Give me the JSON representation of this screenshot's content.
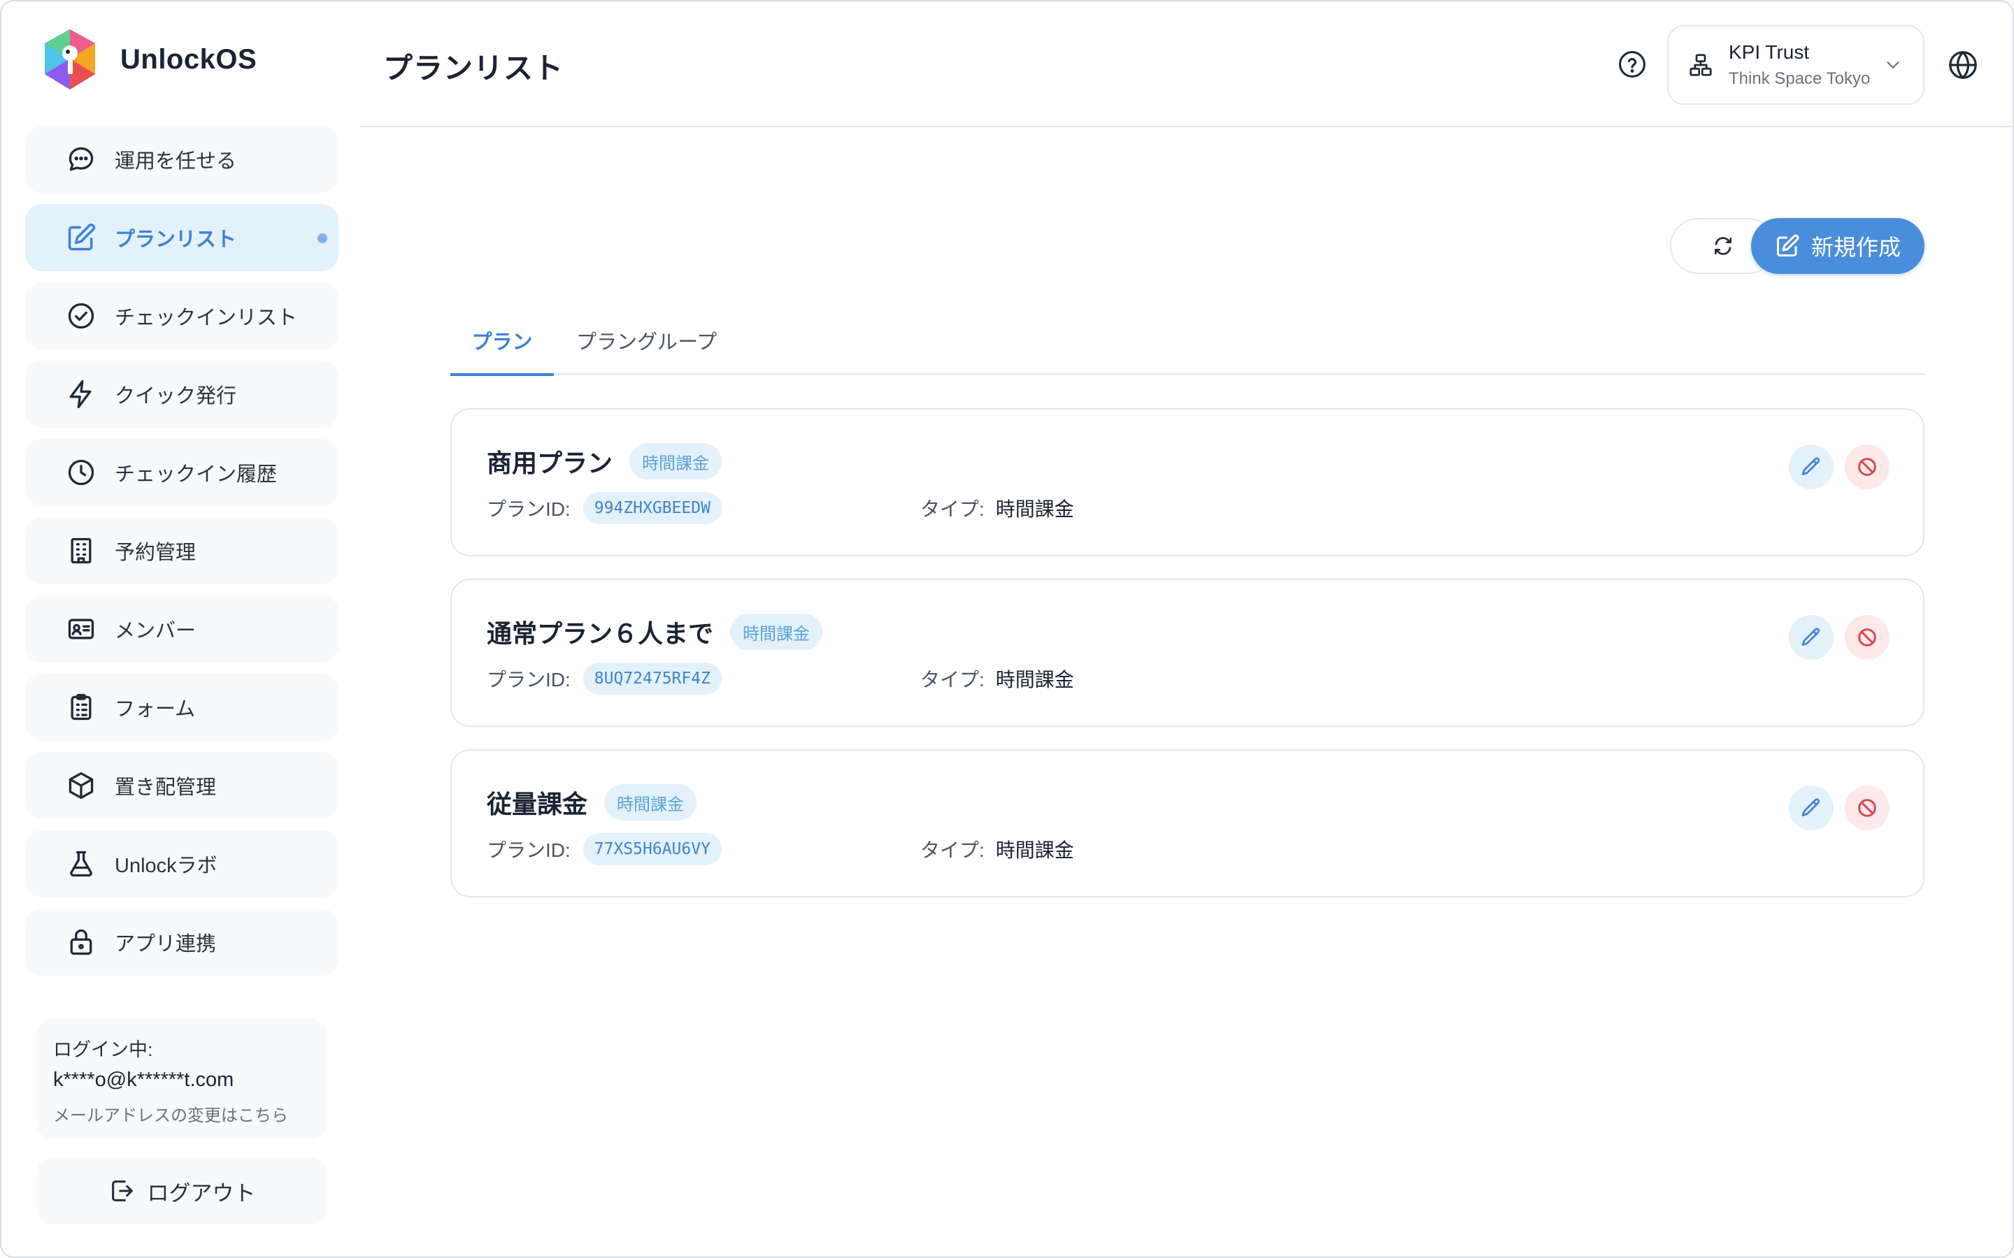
{
  "app": {
    "name": "UnlockOS"
  },
  "sidebar": {
    "items": [
      {
        "label": "運用を任せる",
        "icon": "chat-bubble-icon"
      },
      {
        "label": "プランリスト",
        "icon": "edit-square-icon",
        "active": true
      },
      {
        "label": "チェックインリスト",
        "icon": "check-circle-icon"
      },
      {
        "label": "クイック発行",
        "icon": "lightning-icon"
      },
      {
        "label": "チェックイン履歴",
        "icon": "clock-icon"
      },
      {
        "label": "予約管理",
        "icon": "building-icon"
      },
      {
        "label": "メンバー",
        "icon": "id-card-icon"
      },
      {
        "label": "フォーム",
        "icon": "clipboard-icon"
      },
      {
        "label": "置き配管理",
        "icon": "package-icon"
      },
      {
        "label": "Unlockラボ",
        "icon": "flask-icon"
      },
      {
        "label": "アプリ連携",
        "icon": "lock-icon"
      }
    ],
    "login": {
      "label": "ログイン中:",
      "email": "k****o@k******t.com",
      "change_link": "メールアドレスの変更はこちら"
    },
    "logout_label": "ログアウト"
  },
  "header": {
    "title": "プランリスト",
    "org": {
      "name": "KPI Trust",
      "space": "Think Space Tokyo"
    }
  },
  "toolbar": {
    "new_label": "新規作成"
  },
  "tabs": [
    {
      "label": "プラン",
      "active": true
    },
    {
      "label": "プラングループ",
      "active": false
    }
  ],
  "plans": [
    {
      "name": "商用プラン",
      "badge": "時間課金",
      "id_label": "プランID:",
      "id": "994ZHXGBEEDW",
      "type_label": "タイプ:",
      "type": "時間課金"
    },
    {
      "name": "通常プラン６人まで",
      "badge": "時間課金",
      "id_label": "プランID:",
      "id": "8UQ72475RF4Z",
      "type_label": "タイプ:",
      "type": "時間課金"
    },
    {
      "name": "従量課金",
      "badge": "時間課金",
      "id_label": "プランID:",
      "id": "77XS5H6AU6VY",
      "type_label": "タイプ:",
      "type": "時間課金"
    }
  ],
  "colors": {
    "accent": "#4a8ddc",
    "danger": "#d9464f",
    "chip_bg": "#e3f1fb"
  }
}
